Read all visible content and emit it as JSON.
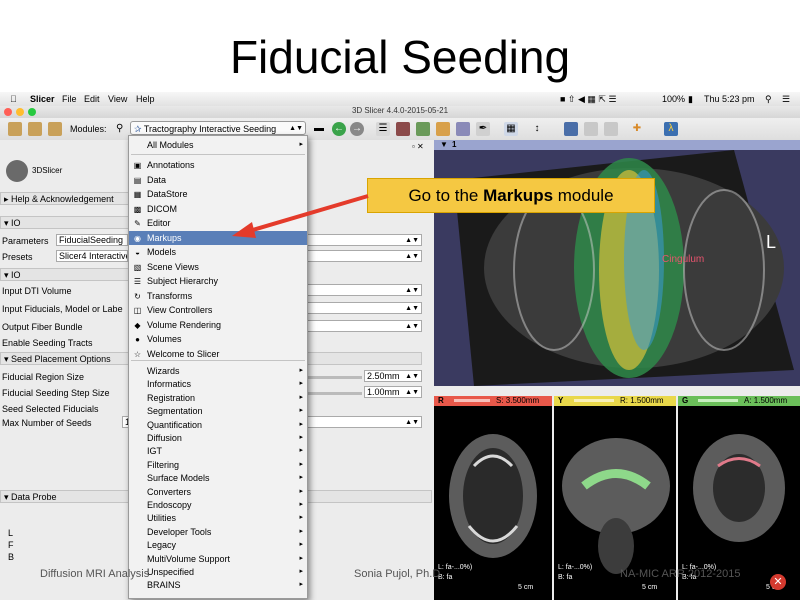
{
  "slide": {
    "title": "Fiducial Seeding",
    "footer_left": "Diffusion MRI Analysis",
    "footer_center": "Sonia Pujol, Ph.D.",
    "footer_right": "NA-MIC ARR 2012-2015"
  },
  "menubar": {
    "apple": "",
    "app": "Slicer",
    "items": [
      "File",
      "Edit",
      "View",
      "Help"
    ],
    "status": {
      "battery": "100%",
      "time": "Thu 5:23 pm"
    }
  },
  "window": {
    "title": "3D Slicer 4.4.0-2015-05-21"
  },
  "toolbar": {
    "modules_label": "Modules:",
    "module_selected": "Tractography Interactive Seeding"
  },
  "left_panel": {
    "logo_text": "3DSlicer",
    "help_section": "Help & Acknowledgement",
    "io1_section": "IO",
    "parameters_label": "Parameters",
    "parameters_value": "FiducialSeeding",
    "presets_label": "Presets",
    "presets_value": "Slicer4 Interactive",
    "io2_section": "IO",
    "input_dti": "Input DTI Volume",
    "input_fiducials": "Input Fiducials, Model or Labe",
    "output_fiber": "Output Fiber Bundle",
    "enable_seeding": "Enable Seeding Tracts",
    "seed_section": "Seed Placement Options",
    "region_size_label": "Fiducial Region Size",
    "region_size_value": "2.50mm",
    "step_size_label": "Fiducial Seeding Step Size",
    "step_size_value": "1.00mm",
    "seed_selected": "Seed Selected Fiducials",
    "max_seeds_label": "Max Number of Seeds",
    "max_seeds_value": "1",
    "data_probe": "Data Probe",
    "probe_letters": [
      "L",
      "F",
      "B"
    ]
  },
  "modules_menu": {
    "top": [
      {
        "label": "All Modules",
        "icon": "",
        "submenu": true
      }
    ],
    "items": [
      {
        "label": "Annotations",
        "icon": "annotations-icon"
      },
      {
        "label": "Data",
        "icon": "data-icon"
      },
      {
        "label": "DataStore",
        "icon": "datastore-icon"
      },
      {
        "label": "DICOM",
        "icon": "dicom-icon"
      },
      {
        "label": "Editor",
        "icon": "editor-icon"
      },
      {
        "label": "Markups",
        "icon": "markups-icon",
        "selected": true
      },
      {
        "label": "Models",
        "icon": "models-icon"
      },
      {
        "label": "Scene Views",
        "icon": "scene-views-icon"
      },
      {
        "label": "Subject Hierarchy",
        "icon": "subject-hierarchy-icon"
      },
      {
        "label": "Transforms",
        "icon": "transforms-icon"
      },
      {
        "label": "View Controllers",
        "icon": "view-controllers-icon"
      },
      {
        "label": "Volume Rendering",
        "icon": "volume-rendering-icon"
      },
      {
        "label": "Volumes",
        "icon": "volumes-icon"
      },
      {
        "label": "Welcome to Slicer",
        "icon": "welcome-icon"
      }
    ],
    "categories": [
      "Wizards",
      "Informatics",
      "Registration",
      "Segmentation",
      "Quantification",
      "Diffusion",
      "IGT",
      "Filtering",
      "Surface Models",
      "Converters",
      "Endoscopy",
      "Utilities",
      "Developer Tools",
      "Legacy",
      "MultiVolume Support",
      "Unspecified",
      "BRAINS"
    ]
  },
  "callout": {
    "prefix": "Go to the ",
    "bold": "Markups",
    "suffix": " module"
  },
  "viewer3d": {
    "label": "1",
    "orientation": "L",
    "tract_label": "Cingulum"
  },
  "slices": [
    {
      "id": "R",
      "value": "S: 3.500mm",
      "color": "#e8584a",
      "info1": "L: fa-...0%)",
      "info2": "B: fa"
    },
    {
      "id": "Y",
      "value": "R: 1.500mm",
      "color": "#e9d84a",
      "info1": "L: fa-...0%)",
      "info2": "B: fa"
    },
    {
      "id": "G",
      "value": "A: 1.500mm",
      "color": "#6bbf5a",
      "info1": "L: fa-...0%)",
      "info2": "B: fa"
    }
  ],
  "scale_label": "5 cm"
}
